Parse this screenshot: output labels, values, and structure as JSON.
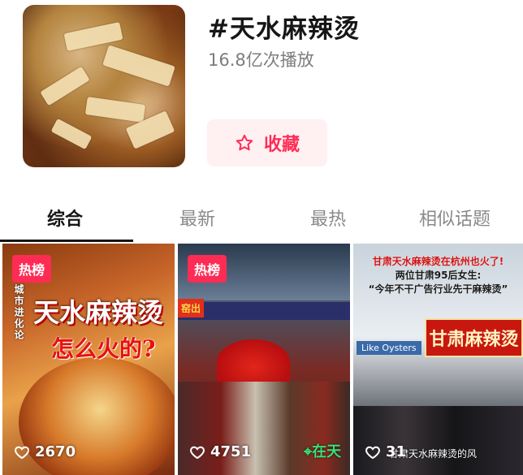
{
  "topic": {
    "title": "#天水麻辣烫",
    "plays": "16.8亿次播放",
    "favorite_label": "收藏"
  },
  "tabs": [
    {
      "label": "综合",
      "active": true
    },
    {
      "label": "最新",
      "active": false
    },
    {
      "label": "最热",
      "active": false
    },
    {
      "label": "相似话题",
      "active": false
    }
  ],
  "cards": [
    {
      "badge": "热榜",
      "side_text": "城市进化论",
      "headline_1": "天水麻辣烫",
      "headline_2": "怎么火的?",
      "likes": "2670"
    },
    {
      "badge": "热榜",
      "side_sign": "窑出",
      "location": "在天",
      "likes": "4751"
    },
    {
      "caption_line_1": "甘肃天水麻辣烫在杭州也火了!",
      "caption_line_2": "两位甘肃95后女生:",
      "caption_line_3": "“今年不干广告行业先干麻辣烫”",
      "shop_sign": "甘肃麻辣烫",
      "store_label": "Like Oysters",
      "subtitle": "甘肃天水麻辣烫的风",
      "likes": "31"
    }
  ],
  "colors": {
    "accent": "#fe2c55",
    "favorite_bg": "#fff0f2",
    "tab_active": "#161616",
    "tab_inactive": "#8a8a8a"
  },
  "icons": {
    "favorite": "star-outline-icon",
    "like": "heart-outline-icon",
    "location": "location-pin-icon"
  }
}
